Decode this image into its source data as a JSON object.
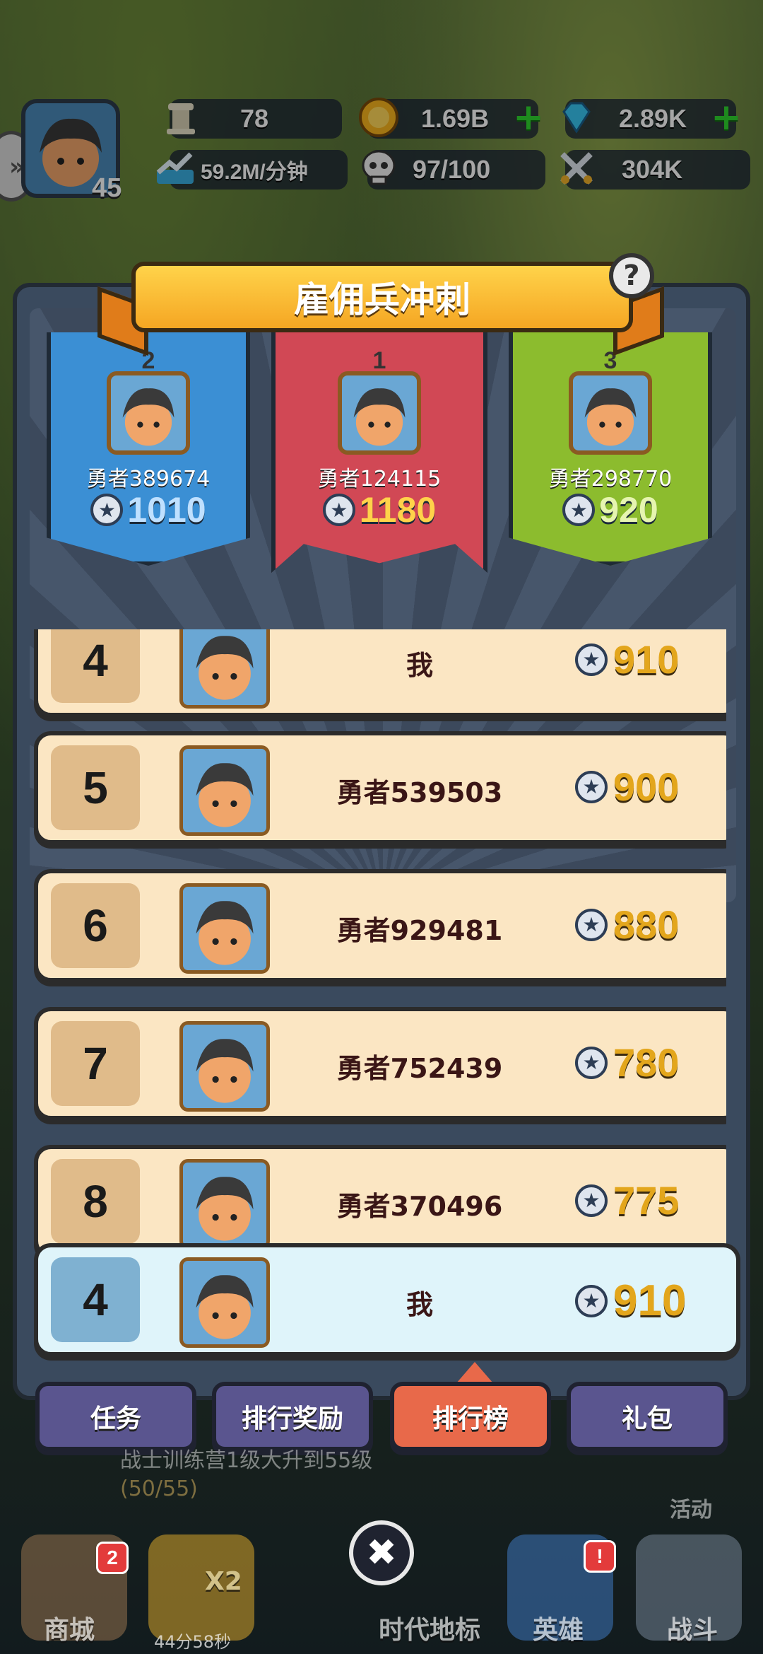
{
  "hud": {
    "player_level": "45",
    "pillar_count": "78",
    "gold": "1.69B",
    "gems": "2.89K",
    "income_rate": "59.2M/分钟",
    "population": "97/100",
    "power": "304K"
  },
  "panel": {
    "title": "雇佣兵冲刺",
    "help_glyph": "?"
  },
  "podium": [
    {
      "rank": "2",
      "name": "勇者389674",
      "score": "1010",
      "color": "#3b8fd4",
      "score_color": "#bfe0ff"
    },
    {
      "rank": "1",
      "name": "勇者124115",
      "score": "1180",
      "color": "#d14855",
      "score_color": "#ffd24a"
    },
    {
      "rank": "3",
      "name": "勇者298770",
      "score": "920",
      "color": "#8cbc2e",
      "score_color": "#e6f5b0"
    }
  ],
  "rows": [
    {
      "rank": "4",
      "name": "我",
      "score": "910"
    },
    {
      "rank": "5",
      "name": "勇者539503",
      "score": "900"
    },
    {
      "rank": "6",
      "name": "勇者929481",
      "score": "880"
    },
    {
      "rank": "7",
      "name": "勇者752439",
      "score": "780"
    },
    {
      "rank": "8",
      "name": "勇者370496",
      "score": "775"
    }
  ],
  "my_row": {
    "rank": "4",
    "name": "我",
    "score": "910"
  },
  "tabs": [
    {
      "label": "任务",
      "active": false
    },
    {
      "label": "排行奖励",
      "active": false
    },
    {
      "label": "排行榜",
      "active": true
    },
    {
      "label": "礼包",
      "active": false
    }
  ],
  "background": {
    "quest_text": "战士训练营1级大升到55级",
    "quest_progress": "(50/55)",
    "shop_label": "商城",
    "shop_badge": "2",
    "double_label": "X2",
    "double_timer": "44分58秒",
    "landmark_label": "时代地标",
    "hero_label": "英雄",
    "hero_badge": "!",
    "battle_label": "战斗",
    "event_label": "活动"
  },
  "close_glyph": "✖"
}
